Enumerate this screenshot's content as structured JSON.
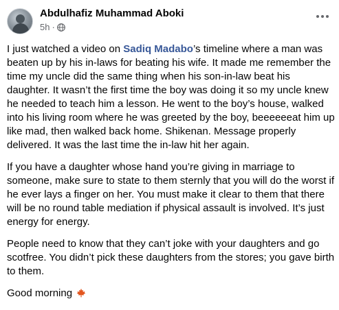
{
  "post": {
    "author": "Abdulhafiz Muhammad Aboki",
    "time": "5h",
    "separator": "·",
    "more_icon": "more-horizontal-icon",
    "privacy_icon": "globe-icon",
    "p1_before": "I just watched a video on ",
    "mention": "Sadiq Madabo",
    "p1_after": "’s timeline where a man was beaten up by his in-laws for beating his wife. It made me remember the time my uncle did the same thing when his son-in-law beat his daughter. It wasn’t the first time the boy was doing it so my uncle knew he needed to teach him a lesson. He went to the boy’s house, walked into his living room where he was greeted by the boy, beeeeeeat him up like mad, then walked back home. Shikenan. Message properly delivered. It was the last time the in-law hit her again.",
    "p2": "If you have a daughter whose hand you’re giving in marriage to someone, make sure to state to them sternly that you will do the worst if he ever lays a finger on her. You must make it clear to them that there will be no round table mediation if physical assault is involved. It’s just energy for energy.",
    "p3": "People need to know that they can’t joke with your daughters and go scotfree. You didn’t pick these daughters from the stores; you gave birth to them.",
    "p4": "Good morning",
    "emoji_icon": "maple-leaf-icon",
    "accent_color": "#385898"
  }
}
